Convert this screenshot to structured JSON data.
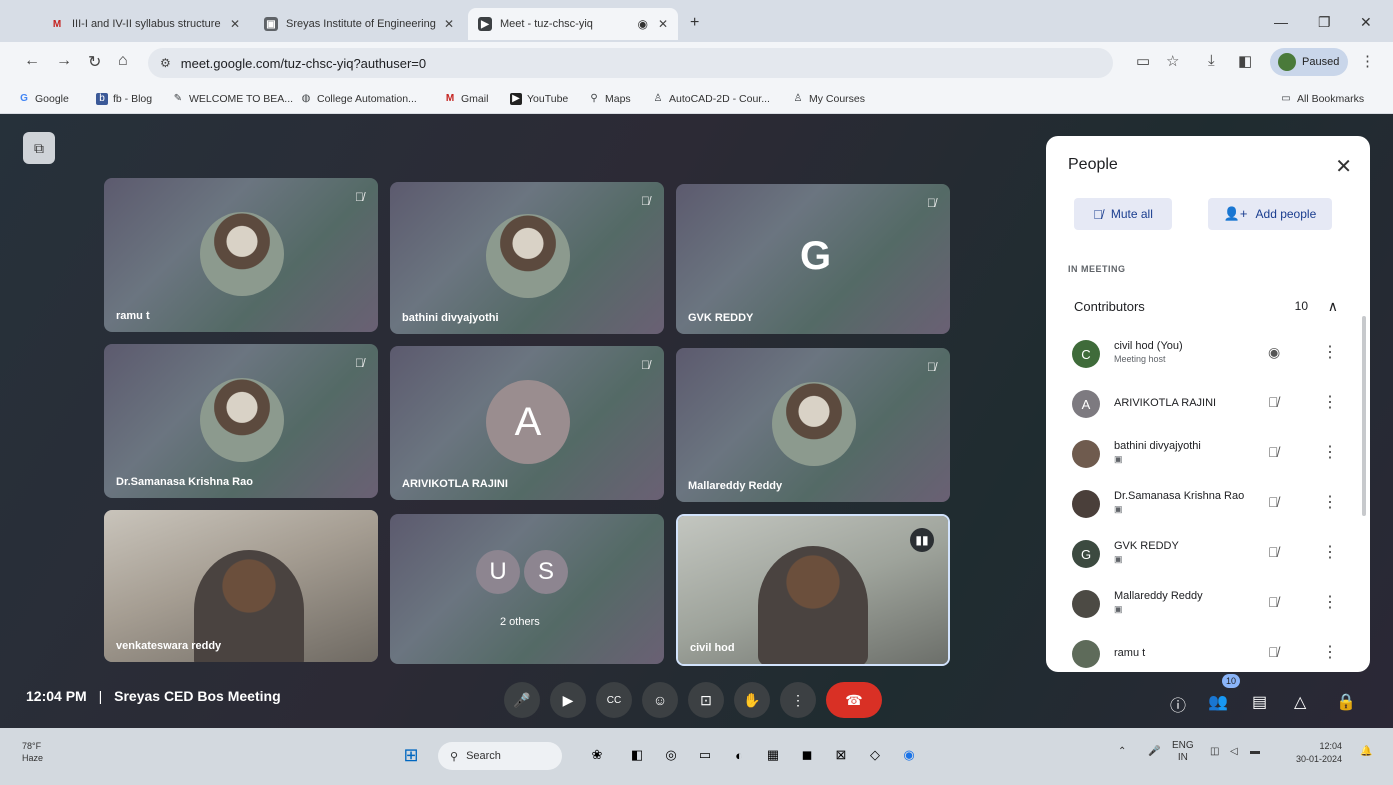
{
  "browser": {
    "tabs": [
      {
        "label": "III-I and IV-II syllabus structure",
        "icon": "gmail-icon"
      },
      {
        "label": "Sreyas Institute of Engineering",
        "icon": "page-icon"
      },
      {
        "label": "Meet - tuz-chsc-yiq",
        "icon": "meet-icon"
      }
    ],
    "new_tab": "+",
    "url": "meet.google.com/tuz-chsc-yiq?authuser=0",
    "profile_status": "Paused",
    "bookmarks": [
      {
        "label": "Google",
        "icon": "google-icon"
      },
      {
        "label": "fb - Blog",
        "icon": "blog-icon"
      },
      {
        "label": "WELCOME TO BEA...",
        "icon": "pen-icon"
      },
      {
        "label": "College Automation...",
        "icon": "globe-icon"
      },
      {
        "label": "Gmail",
        "icon": "gmail-icon"
      },
      {
        "label": "YouTube",
        "icon": "youtube-icon"
      },
      {
        "label": "Maps",
        "icon": "maps-icon"
      },
      {
        "label": "AutoCAD-2D - Cour...",
        "icon": "course-icon"
      },
      {
        "label": "My Courses",
        "icon": "course-icon"
      }
    ],
    "all_bookmarks": "All Bookmarks"
  },
  "tiles": [
    {
      "name": "ramu t",
      "kind": "photo"
    },
    {
      "name": "bathini divyajyothi",
      "kind": "photo"
    },
    {
      "name": "GVK REDDY",
      "kind": "letter",
      "letter": "G"
    },
    {
      "name": "Dr.Samanasa Krishna Rao",
      "kind": "photo"
    },
    {
      "name": "ARIVIKOTLA RAJINI",
      "kind": "letter",
      "letter": "A"
    },
    {
      "name": "Mallareddy Reddy",
      "kind": "photo"
    },
    {
      "name": "venkateswara reddy",
      "kind": "video"
    },
    {
      "name": "2 others",
      "kind": "others",
      "letters": [
        "U",
        "S"
      ]
    },
    {
      "name": "civil hod",
      "kind": "video"
    }
  ],
  "people_panel": {
    "title": "People",
    "mute_all": "Mute all",
    "add_people": "Add people",
    "section_label": "IN MEETING",
    "group_label": "Contributors",
    "group_count": "10",
    "participants": [
      {
        "name": "civil hod (You)",
        "subtitle": "Meeting host",
        "avatar": "C",
        "avatar_color": "#3f6b3a"
      },
      {
        "name": "ARIVIKOTLA RAJINI",
        "subtitle": "",
        "avatar": "A",
        "avatar_color": "#7d7a80"
      },
      {
        "name": "bathini divyajyothi",
        "subtitle": "",
        "avatar": "",
        "avatar_color": "#6f5b4e"
      },
      {
        "name": "Dr.Samanasa Krishna Rao",
        "subtitle": "",
        "avatar": "",
        "avatar_color": "#4a3f3a"
      },
      {
        "name": "GVK REDDY",
        "subtitle": "",
        "avatar": "G",
        "avatar_color": "#3c4a40"
      },
      {
        "name": "Mallareddy Reddy",
        "subtitle": "",
        "avatar": "",
        "avatar_color": "#4c4a44"
      },
      {
        "name": "ramu t",
        "subtitle": "",
        "avatar": "",
        "avatar_color": "#5e6b5a"
      }
    ]
  },
  "bottom": {
    "time": "12:04 PM",
    "separator": "|",
    "meeting_name": "Sreyas CED Bos Meeting",
    "participants_badge": "10"
  },
  "taskbar": {
    "temp": "78°F",
    "weather": "Haze",
    "search": "Search",
    "lang1": "ENG",
    "lang2": "IN",
    "time": "12:04",
    "date": "30-01-2024"
  }
}
